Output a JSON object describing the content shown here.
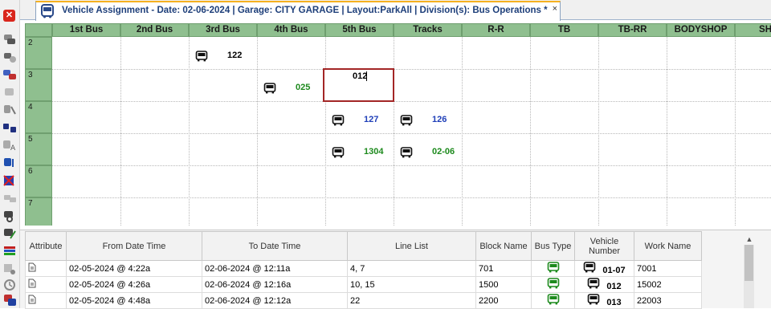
{
  "window": {
    "tab_title": "Vehicle Assignment - Date: 02-06-2024 | Garage: CITY GARAGE | Layout:ParkAll | Division(s): Bus Operations  *",
    "tab_close": "×",
    "close_glyph": "✕"
  },
  "grid": {
    "columns": [
      "1st Bus",
      "2nd Bus",
      "3rd Bus",
      "4th Bus",
      "5th Bus",
      "Tracks",
      "R-R",
      "TB",
      "TB-RR",
      "BODYSHOP",
      "SHO"
    ],
    "rows": [
      "2",
      "3",
      "4",
      "5",
      "6",
      "7"
    ],
    "vehicles": [
      {
        "row": "2",
        "column": "3rd Bus",
        "number": "122",
        "color": "#000000"
      },
      {
        "row": "3",
        "column": "4th Bus",
        "number": "025",
        "color": "#1d8a1d"
      },
      {
        "row": "4",
        "column": "5th Bus",
        "number": "127",
        "color": "#1f3fb8"
      },
      {
        "row": "4",
        "column": "Tracks",
        "number": "126",
        "color": "#1f3fb8"
      },
      {
        "row": "5",
        "column": "5th Bus",
        "number": "1304",
        "color": "#1d8a1d"
      },
      {
        "row": "5",
        "column": "Tracks",
        "number": "02-06",
        "color": "#1d8a1d"
      }
    ],
    "edit_cell": {
      "row": "3",
      "column": "5th Bus",
      "value": "012"
    }
  },
  "table": {
    "headers": {
      "attribute": "Attribute",
      "from": "From Date Time",
      "to": "To Date  Time",
      "line_list": "Line List",
      "block_name": "Block Name",
      "bus_type": "Bus Type",
      "vehicle_number": "Vehicle Number",
      "work_name": "Work Name"
    },
    "rows": [
      {
        "from": "02-05-2024 @  4:22a",
        "to": "02-06-2024 @ 12:11a",
        "line_list": "4, 7",
        "block": "701",
        "vehicle": "01-07",
        "work": "7001"
      },
      {
        "from": "02-05-2024 @  4:26a",
        "to": "02-06-2024 @ 12:16a",
        "line_list": "10, 15",
        "block": "1500",
        "vehicle": "012",
        "work": "15002"
      },
      {
        "from": "02-05-2024 @  4:48a",
        "to": "02-06-2024 @ 12:12a",
        "line_list": "22",
        "block": "2200",
        "vehicle": "013",
        "work": "22003"
      }
    ],
    "scroll_up_glyph": "▲"
  },
  "icons": {
    "bus_icon": "bus-icon",
    "bus_type_icon": "green-bus-icon",
    "document_icon": "document-icon"
  }
}
